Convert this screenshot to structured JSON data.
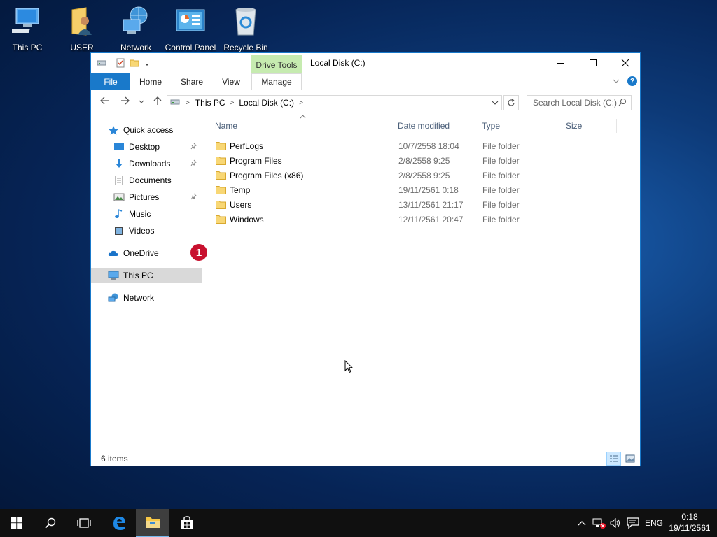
{
  "desktop": {
    "icons": [
      {
        "label": "This PC",
        "icon": "this-pc-icon"
      },
      {
        "label": "USER",
        "icon": "user-folder-icon"
      },
      {
        "label": "Network",
        "icon": "network-icon"
      },
      {
        "label": "Control Panel",
        "icon": "control-panel-icon"
      },
      {
        "label": "Recycle Bin",
        "icon": "recycle-bin-icon"
      }
    ]
  },
  "window": {
    "title": "Local Disk (C:)",
    "context_tab": "Drive Tools",
    "ribbon_tabs": [
      "File",
      "Home",
      "Share",
      "View",
      "Manage"
    ],
    "address": {
      "segments": [
        "This PC",
        "Local Disk (C:)"
      ]
    },
    "search_placeholder": "Search Local Disk (C:)",
    "nav": {
      "quick_access": "Quick access",
      "pinned": [
        {
          "label": "Desktop",
          "icon": "desktop-icon"
        },
        {
          "label": "Downloads",
          "icon": "downloads-icon"
        },
        {
          "label": "Documents",
          "icon": "documents-icon"
        },
        {
          "label": "Pictures",
          "icon": "pictures-icon"
        },
        {
          "label": "Music",
          "icon": "music-icon"
        },
        {
          "label": "Videos",
          "icon": "videos-icon"
        }
      ],
      "onedrive": "OneDrive",
      "this_pc": "This PC",
      "network": "Network",
      "badge": "1"
    },
    "columns": [
      "Name",
      "Date modified",
      "Type",
      "Size"
    ],
    "files": [
      {
        "name": "PerfLogs",
        "date": "10/7/2558 18:04",
        "type": "File folder"
      },
      {
        "name": "Program Files",
        "date": "2/8/2558 9:25",
        "type": "File folder"
      },
      {
        "name": "Program Files (x86)",
        "date": "2/8/2558 9:25",
        "type": "File folder"
      },
      {
        "name": "Temp",
        "date": "19/11/2561 0:18",
        "type": "File folder"
      },
      {
        "name": "Users",
        "date": "13/11/2561 21:17",
        "type": "File folder"
      },
      {
        "name": "Windows",
        "date": "12/11/2561 20:47",
        "type": "File folder"
      }
    ],
    "status": "6 items"
  },
  "taskbar": {
    "language": "ENG",
    "time": "0:18",
    "date": "19/11/2561"
  },
  "colors": {
    "accent": "#1979ca",
    "context_tab": "#c6ebb0",
    "badge": "#c8102e",
    "folder": "#f8d775"
  }
}
